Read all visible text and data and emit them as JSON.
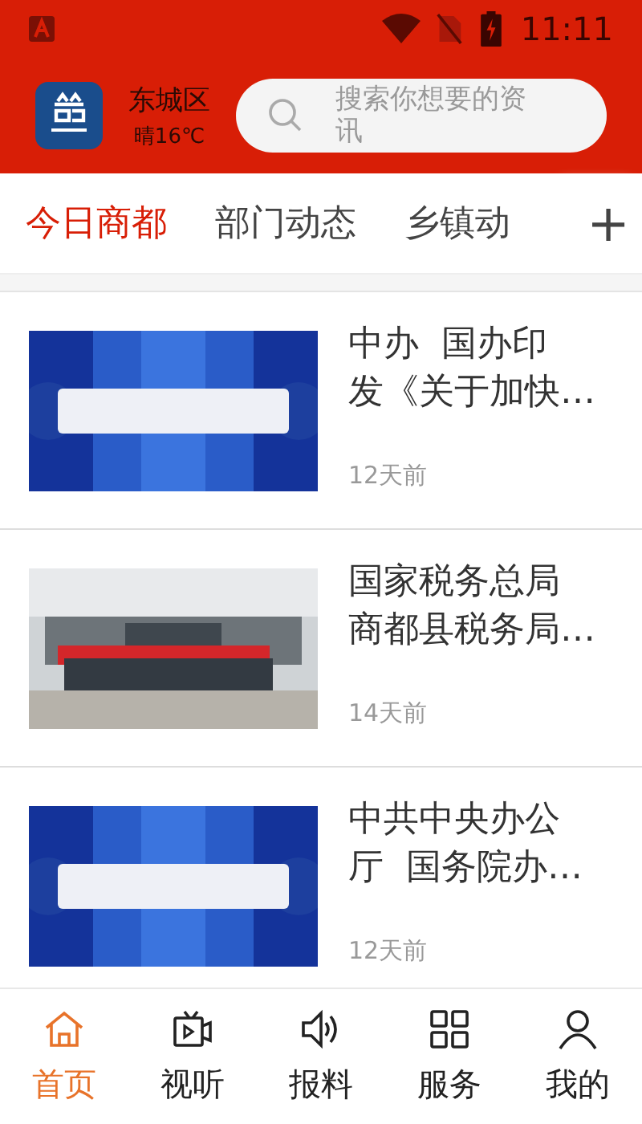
{
  "status_bar": {
    "time": "11:11"
  },
  "header": {
    "district": "东城区",
    "weather": "晴16℃",
    "search": {
      "placeholder": "搜索你想要的资讯"
    }
  },
  "tabs": [
    {
      "label": "今日商都",
      "selected": true
    },
    {
      "label": "部门动态",
      "selected": false
    },
    {
      "label": "乡镇动",
      "selected": false
    }
  ],
  "add_tab": "+",
  "news": [
    {
      "title_lines": [
        "中办  国办印",
        "发《关于加快…"
      ],
      "time": "12天前"
    },
    {
      "title_lines": [
        "国家税务总局",
        "商都县税务局…"
      ],
      "time": "14天前"
    },
    {
      "title_lines": [
        "中共中央办公",
        "厅  国务院办…"
      ],
      "time": "12天前"
    }
  ],
  "nav": [
    {
      "label": "首页",
      "selected": true
    },
    {
      "label": "视听",
      "selected": false
    },
    {
      "label": "报料",
      "selected": false
    },
    {
      "label": "服务",
      "selected": false
    },
    {
      "label": "我的",
      "selected": false
    }
  ]
}
